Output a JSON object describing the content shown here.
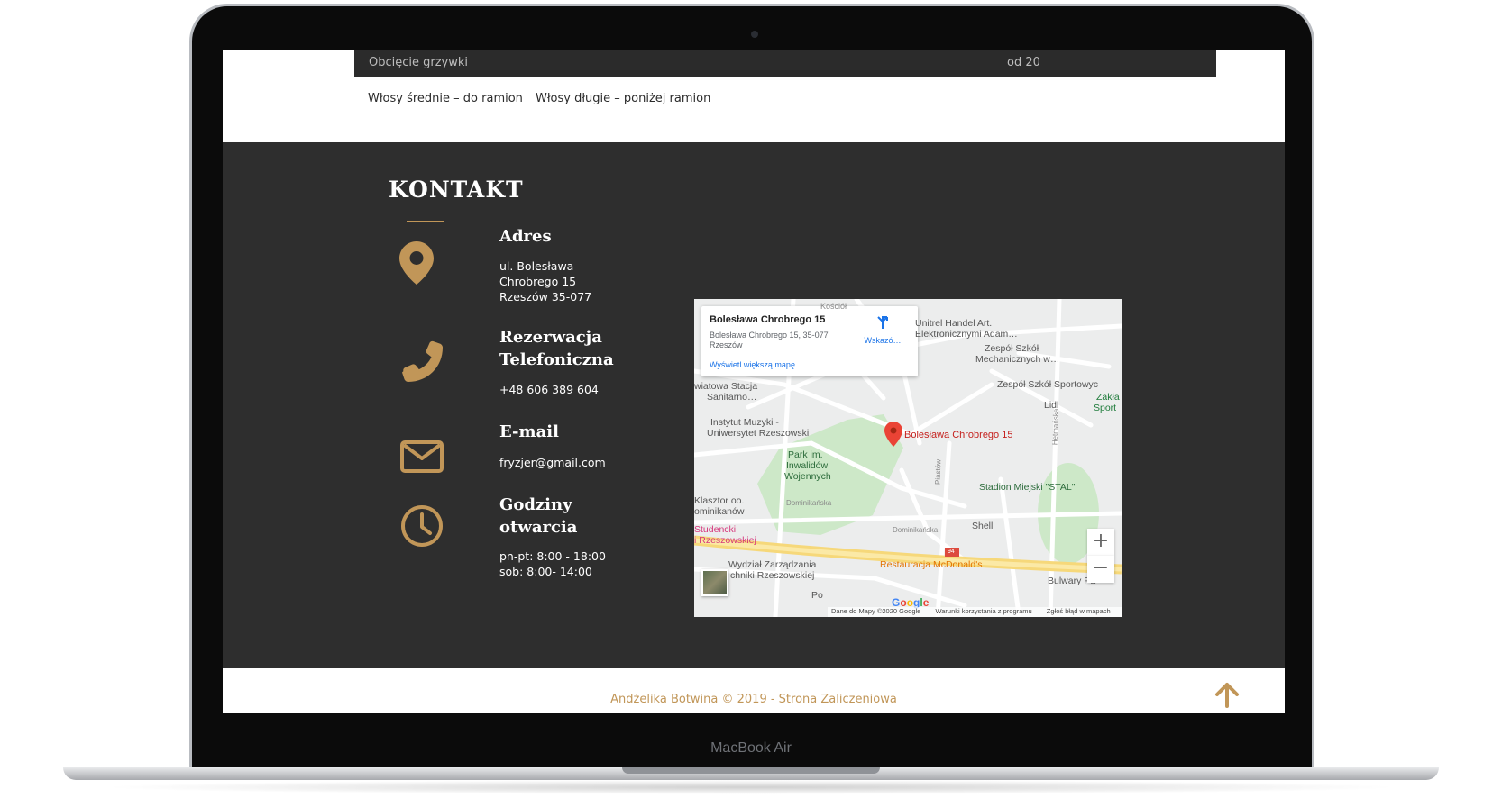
{
  "device": {
    "label": "MacBook Air"
  },
  "pricing": {
    "row_name": "Obcięcie grzywki",
    "row_price": "od 20",
    "tabs": [
      "Włosy średnie – do ramion",
      "Włosy długie – poniżej ramion"
    ]
  },
  "contact": {
    "title": "KONTAKT",
    "address": {
      "heading": "Adres",
      "lines": [
        "ul. Bolesława",
        "Chrobrego 15",
        "Rzeszów 35-077"
      ],
      "icon": "map-pin-icon"
    },
    "phone": {
      "heading_lines": [
        "Rezerwacja",
        "Telefoniczna"
      ],
      "number": "+48 606 389 604",
      "icon": "phone-icon"
    },
    "email": {
      "heading": "E-mail",
      "address": "fryzjer@gmail.com",
      "icon": "envelope-icon"
    },
    "hours": {
      "heading_lines": [
        "Godziny",
        "otwarcia"
      ],
      "lines": [
        "pn-pt: 8:00 - 18:00",
        "sob: 8:00- 14:00"
      ],
      "icon": "clock-icon"
    },
    "accent_color": "#c19658",
    "background_color": "#2e2e2e"
  },
  "map": {
    "card_title": "Bolesława Chrobrego 15",
    "card_address": "Bolesława Chrobrego 15, 35-077 Rzeszów",
    "card_directions": "Wskazó…",
    "card_link": "Wyświetl większą mapę",
    "marker_label": "Bolesława Chrobrego 15",
    "labels": {
      "unitrel": "Unitrel Handel Art.",
      "unitrel2": "Elektronicznymi Adam…",
      "zss_mech": "Zespół Szkół",
      "zss_mech2": "Mechanicznych w…",
      "zss_sport": "Zespół Szkół Sportowyc",
      "lidl": "Lidl",
      "zaklad": "Zakła",
      "sport": "Sport",
      "sanitarno": "wiatowa Stacja",
      "sanitarno2": "Sanitarno…",
      "instytut": "Instytut Muzyki -",
      "instytut2": "Uniwersytet Rzeszowski",
      "park": "Park im.",
      "park2": "Inwalidów",
      "park3": "Wojennych",
      "stadion": "Stadion Miejski \"STAL\"",
      "klasztor": "Klasztor oo.",
      "klasztor2": "ominikanów",
      "dominikanska": "Dominikańska",
      "dominikanska2": "Dominikańska",
      "shell": "Shell",
      "studencki": "Studencki",
      "studencki2": "i Rzeszowskiej",
      "road94": "94",
      "wydzial": "Wydział Zarządzania",
      "wydzial2": "chniki Rzeszowskiej",
      "mcdonalds": "Restauracja McDonald's",
      "bulwary": "Bulwary Pa",
      "hetmanska": "Hetmańska",
      "plastow": "Piastów",
      "kosciol": "Kościół",
      "po": "Po"
    },
    "zoom_in": "+",
    "zoom_out": "−",
    "google": "Google",
    "footer": [
      "Dane do Mapy ©2020 Google",
      "Warunki korzystania z programu",
      "Zgłoś błąd w mapach"
    ]
  },
  "footer": {
    "text": "Andżelika Botwina © 2019 - Strona Zaliczeniowa",
    "to_top_icon": "arrow-up-icon"
  }
}
